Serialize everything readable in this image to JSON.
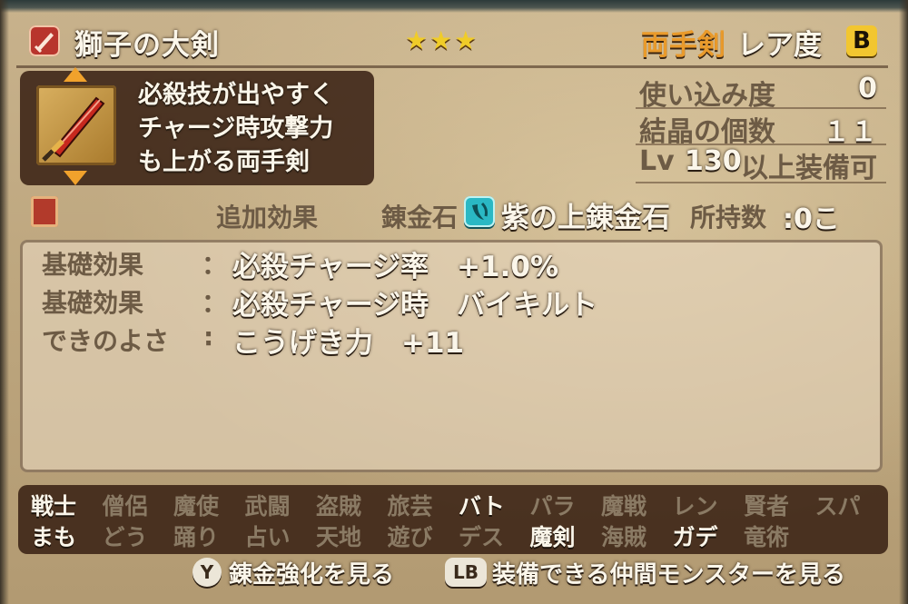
{
  "item": {
    "name": "獅子の大剣",
    "stars": "★★★",
    "weapon_class": "両手剣",
    "rarity_label": "レア度",
    "rarity_grade": "B",
    "description_lines": [
      "必殺技が出やすく",
      "チャージ時攻撃力",
      "も上がる両手剣"
    ],
    "icons": {
      "type_icon": "sword-type-icon",
      "image": "red-greatsword-icon",
      "up": "arrow-up-icon",
      "down": "arrow-down-icon"
    }
  },
  "stats": {
    "usage_label": "使い込み度",
    "usage_value": "0",
    "crystal_label": "結晶の個数",
    "crystal_value": "１１",
    "lv_label": "Lv",
    "lv_value": "130",
    "lv_suffix": "以上装備可"
  },
  "alchemy": {
    "book_icon": "book-icon",
    "extra_effect_label": "追加効果",
    "stone_label": "錬金石",
    "stone_icon": "alchemy-stone-icon",
    "stone_name": "紫の上錬金石",
    "owned_label": "所持数",
    "owned_value": ":0こ"
  },
  "effects": [
    {
      "label": "基礎効果",
      "sep": "：",
      "value": "必殺チャージ率　+1.0%"
    },
    {
      "label": "基礎効果",
      "sep": "：",
      "value": "必殺チャージ時　バイキルト"
    },
    {
      "label": "できのよさ",
      "sep": ":",
      "value": "こうげき力　+11"
    }
  ],
  "jobs": [
    {
      "name": "戦士",
      "on": true
    },
    {
      "name": "僧侶",
      "on": false
    },
    {
      "name": "魔使",
      "on": false
    },
    {
      "name": "武闘",
      "on": false
    },
    {
      "name": "盗賊",
      "on": false
    },
    {
      "name": "旅芸",
      "on": false
    },
    {
      "name": "バト",
      "on": true
    },
    {
      "name": "パラ",
      "on": false
    },
    {
      "name": "魔戦",
      "on": false
    },
    {
      "name": "レン",
      "on": false
    },
    {
      "name": "賢者",
      "on": false
    },
    {
      "name": "スパ",
      "on": false
    },
    {
      "name": "まも",
      "on": true
    },
    {
      "name": "どう",
      "on": false
    },
    {
      "name": "踊り",
      "on": false
    },
    {
      "name": "占い",
      "on": false
    },
    {
      "name": "天地",
      "on": false
    },
    {
      "name": "遊び",
      "on": false
    },
    {
      "name": "デス",
      "on": false
    },
    {
      "name": "魔剣",
      "on": true
    },
    {
      "name": "海賊",
      "on": false
    },
    {
      "name": "ガデ",
      "on": true
    },
    {
      "name": "竜術",
      "on": false
    }
  ],
  "hints": {
    "y_button": "Y",
    "y_text": "錬金強化を見る",
    "lb_button": "LB",
    "lb_text": "装備できる仲間モンスターを見る"
  },
  "colors": {
    "text_light": "#fbf6ea",
    "text_orange": "#e99a2b",
    "star_gold": "#f0cc28",
    "grade_badge": "#f2c630",
    "stone_cyan": "#2ab8c4",
    "panel_dark": "#3a2214",
    "job_inactive": "#8a7a64"
  }
}
